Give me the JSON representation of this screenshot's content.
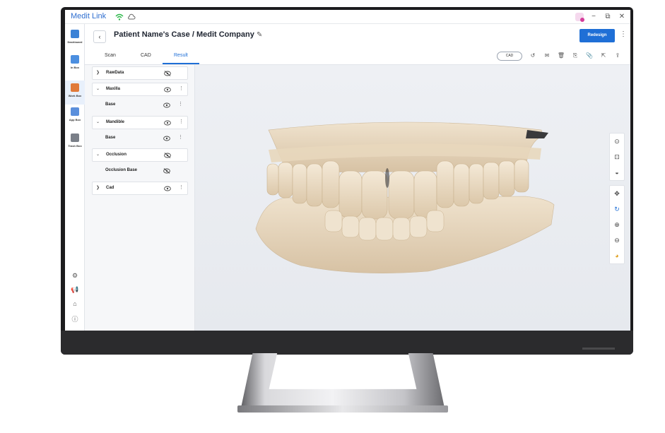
{
  "app": {
    "title": "Medit Link"
  },
  "window": {
    "notification_icon": "notification-icon",
    "minimize": "−",
    "restore": "⧉",
    "close": "✕"
  },
  "sidenav": {
    "items": [
      {
        "label": "Dashboard",
        "icon": "dashboard-icon",
        "color": "#3b82d6"
      },
      {
        "label": "In Box",
        "icon": "inbox-icon",
        "color": "#4c8fe0"
      },
      {
        "label": "Work Box",
        "icon": "workbox-icon",
        "color": "#e07a3a"
      },
      {
        "label": "App Box",
        "icon": "appbox-icon",
        "color": "#5a8fdc"
      },
      {
        "label": "Trash Box",
        "icon": "trash-icon",
        "color": "#7a7f88"
      }
    ],
    "bottom": [
      "⚙",
      "📢",
      "⌂",
      "ⓘ"
    ]
  },
  "header": {
    "back": "‹",
    "title": "Patient Name's Case / Medit Company",
    "edit_icon": "✎",
    "primary_button": "Redesign",
    "more": "⋮"
  },
  "tabs": [
    {
      "label": "Scan",
      "active": false
    },
    {
      "label": "CAD",
      "active": false
    },
    {
      "label": "Result",
      "active": true
    }
  ],
  "toolbar": {
    "chip": "CAD",
    "icons": [
      "↺",
      "✉",
      "🗑",
      "⎘",
      "📎",
      "⇱",
      "⇪"
    ]
  },
  "tree": [
    {
      "name": "RawData",
      "type": "group",
      "expanded": false,
      "visible": false
    },
    {
      "name": "Maxilla",
      "type": "group",
      "expanded": true,
      "visible": true
    },
    {
      "name": "Base",
      "type": "child",
      "visible": true
    },
    {
      "name": "Mandible",
      "type": "group",
      "expanded": true,
      "visible": true
    },
    {
      "name": "Base",
      "type": "child",
      "visible": true
    },
    {
      "name": "Occlusion",
      "type": "group",
      "expanded": true,
      "visible": false
    },
    {
      "name": "Occlusion Base",
      "type": "child",
      "visible": false
    },
    {
      "name": "Cad",
      "type": "group",
      "expanded": false,
      "visible": true
    }
  ],
  "side_tools": {
    "group1": [
      "⊙",
      "⊡",
      "◒"
    ],
    "group2": [
      "✥",
      "↻",
      "⊕",
      "⊖",
      "◕"
    ]
  },
  "colors": {
    "accent": "#1f6fd6",
    "model": "#e6d5bd"
  }
}
